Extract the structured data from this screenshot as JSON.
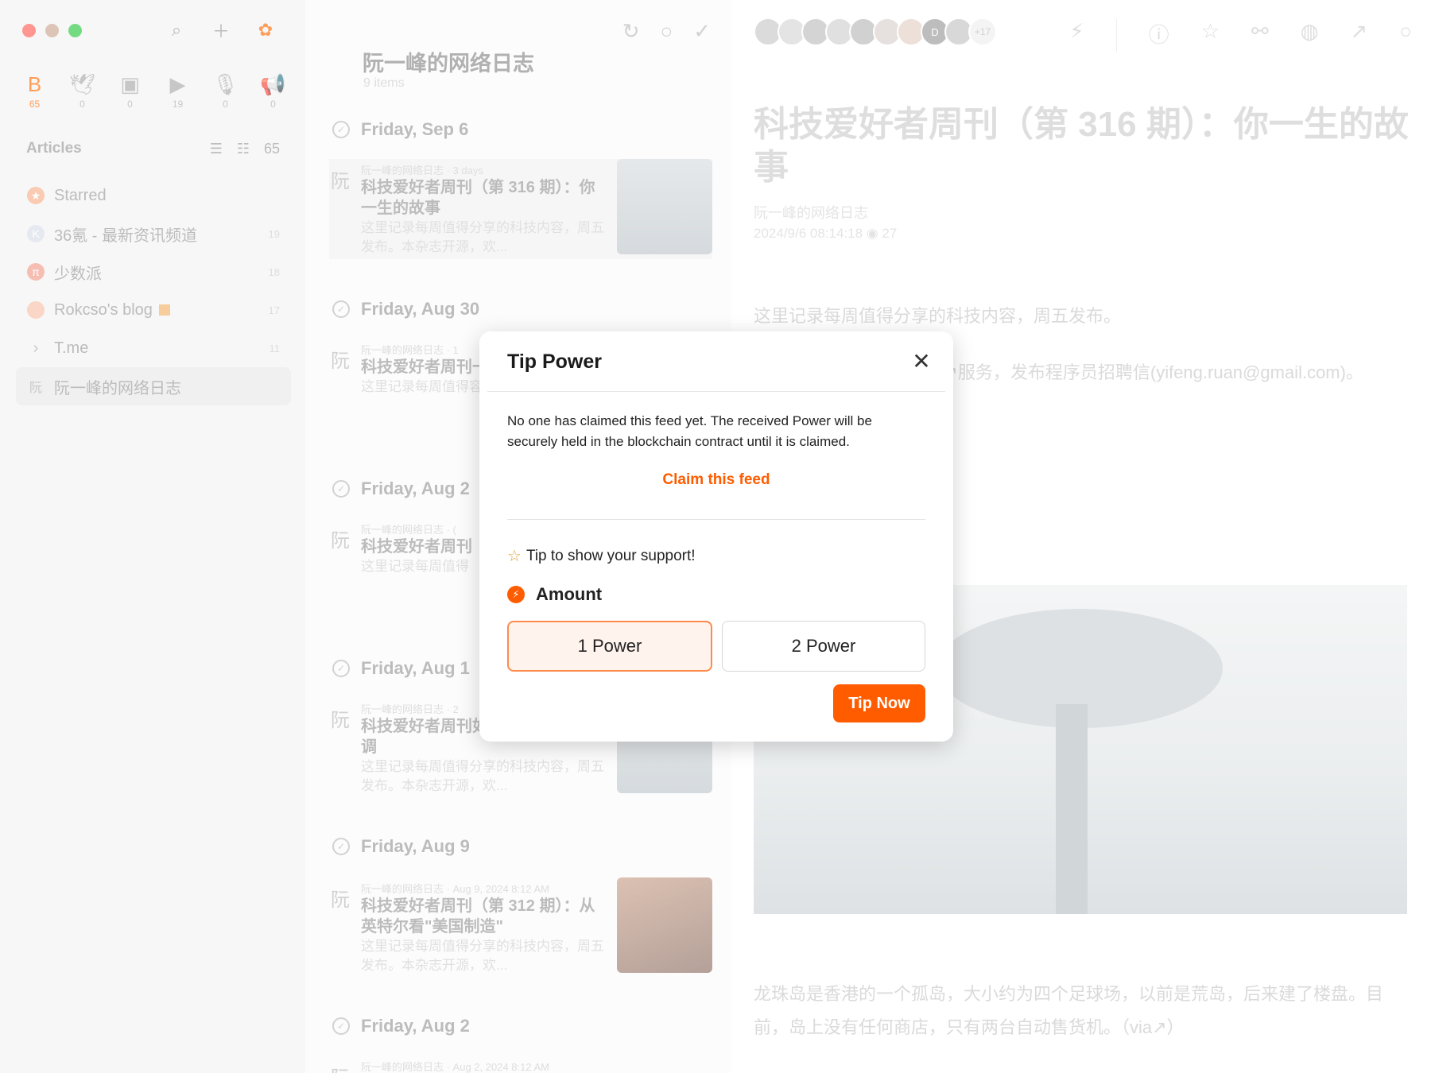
{
  "sidebar": {
    "categories": [
      {
        "icon": "article-icon",
        "glyph": "B",
        "count": "65"
      },
      {
        "icon": "bird-icon",
        "glyph": "🕊",
        "count": "0"
      },
      {
        "icon": "image-icon",
        "glyph": "▣",
        "count": "0"
      },
      {
        "icon": "video-icon",
        "glyph": "▶",
        "count": "19"
      },
      {
        "icon": "microphone-icon",
        "glyph": "🎙",
        "count": "0"
      },
      {
        "icon": "megaphone-icon",
        "glyph": "📢",
        "count": "0"
      }
    ],
    "section_title": "Articles",
    "section_count": "65",
    "feeds": [
      {
        "label": "Starred",
        "count": "",
        "color": "#f6b08a",
        "glyph": "★"
      },
      {
        "label": "36氪 - 最新资讯频道",
        "count": "19",
        "color": "#d9dde8",
        "glyph": "K"
      },
      {
        "label": "少数派",
        "count": "18",
        "color": "#f29b8a",
        "glyph": "π"
      },
      {
        "label": "Rokcso's blog",
        "count": "17",
        "color": "#f6c0a6",
        "glyph": ""
      },
      {
        "label": "T.me",
        "count": "11",
        "color": "transparent",
        "glyph": "›"
      },
      {
        "label": "阮一峰的网络日志",
        "count": "",
        "color": "transparent",
        "glyph": "阮"
      }
    ]
  },
  "list": {
    "title": "阮一峰的网络日志",
    "subtitle": "9 items",
    "days": [
      {
        "label": "Friday, Sep 6"
      },
      {
        "label": "Friday, Aug 30"
      },
      {
        "label": "Friday, Aug 2"
      },
      {
        "label": "Friday, Aug 1"
      },
      {
        "label": "Friday, Aug 9"
      },
      {
        "label": "Friday, Aug 2"
      }
    ],
    "entries": [
      {
        "meta": "阮一峰的网络日志 · 3 days",
        "title": "科技爱好者周刊（第 316 期）：你一生的故事",
        "desc": "这里记录每周值得分享的科技内容，周五发布。本杂志开源，欢..."
      },
      {
        "meta": "阮一峰的网络日志 · 1",
        "title": "科技爱好者周刊一份谷歌离职报",
        "desc": "这里记录每周值得容，周五发布。"
      },
      {
        "meta": "阮一峰的网络日志 · (",
        "title": "科技爱好者周刊《黑神话：悟空吗?",
        "desc": "这里记录每周值得"
      },
      {
        "meta": "阮一峰的网络日志 · 2",
        "title": "科技爱好者周刊如果新加坡没有空调",
        "desc": "这里记录每周值得分享的科技内容，周五发布。本杂志开源，欢..."
      },
      {
        "meta": "阮一峰的网络日志 · Aug 9, 2024 8:12 AM",
        "title": "科技爱好者周刊（第 312 期）：从英特尔看\"美国制造\"",
        "desc": "这里记录每周值得分享的科技内容，周五发布。本杂志开源，欢..."
      },
      {
        "meta": "阮一峰的网络日志 · Aug 2, 2024 8:12 AM",
        "title": "",
        "desc": ""
      }
    ]
  },
  "reader": {
    "avatars_more": "+17",
    "title": "科技爱好者周刊（第 316 期）：你一生的故事",
    "source": "阮一峰的网络日志",
    "date": "2024/9/6 08:14:18",
    "views": "27",
    "p1": "这里记录每周值得分享的科技内容，周五发布。",
    "p2": "稿↗。另有《谁在招人》↗服务，发布程序员招聘信(yifeng.ruan@gmail.com)。",
    "p3": "龙珠岛是香港的一个孤岛，大小约为四个足球场，以前是荒岛，后来建了楼盘。目前，岛上没有任何商店，只有两台自动售货机。（via↗）"
  },
  "modal": {
    "title": "Tip Power",
    "notice": "No one has claimed this feed yet. The received Power will be securely held in the blockchain contract until it is claimed.",
    "claim_label": "Claim this feed",
    "support_text": "Tip to show your support!",
    "amount_label": "Amount",
    "options": [
      "1 Power",
      "2 Power"
    ],
    "selected_option": "1 Power",
    "tip_button": "Tip Now"
  },
  "colors": {
    "accent": "#ff5c00",
    "selected_bg": "#fff3ed"
  }
}
